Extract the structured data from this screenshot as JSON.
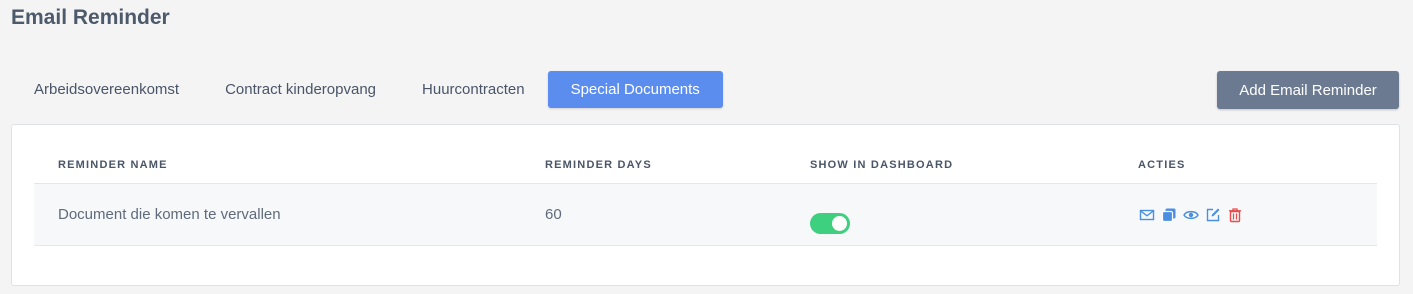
{
  "page": {
    "title": "Email Reminder"
  },
  "tabs": [
    {
      "label": "Arbeidsovereenkomst",
      "active": false
    },
    {
      "label": "Contract kinderopvang",
      "active": false
    },
    {
      "label": "Huurcontracten",
      "active": false
    },
    {
      "label": "Special Documents",
      "active": true
    }
  ],
  "toolbar": {
    "add_label": "Add Email Reminder"
  },
  "table": {
    "columns": [
      "Reminder Name",
      "Reminder Days",
      "Show In Dashboard",
      "Acties"
    ],
    "rows": [
      {
        "name": "Document die komen te vervallen",
        "days": "60",
        "show_in_dashboard": true,
        "actions": [
          "mail-icon",
          "copy-icon",
          "eye-icon",
          "edit-icon",
          "trash-icon"
        ]
      }
    ]
  },
  "colors": {
    "accent": "#5b8def",
    "button": "#6b7a90",
    "toggle_on": "#3ecf7f",
    "action_icon": "#4a8fe0",
    "delete_icon": "#e84b4b"
  }
}
